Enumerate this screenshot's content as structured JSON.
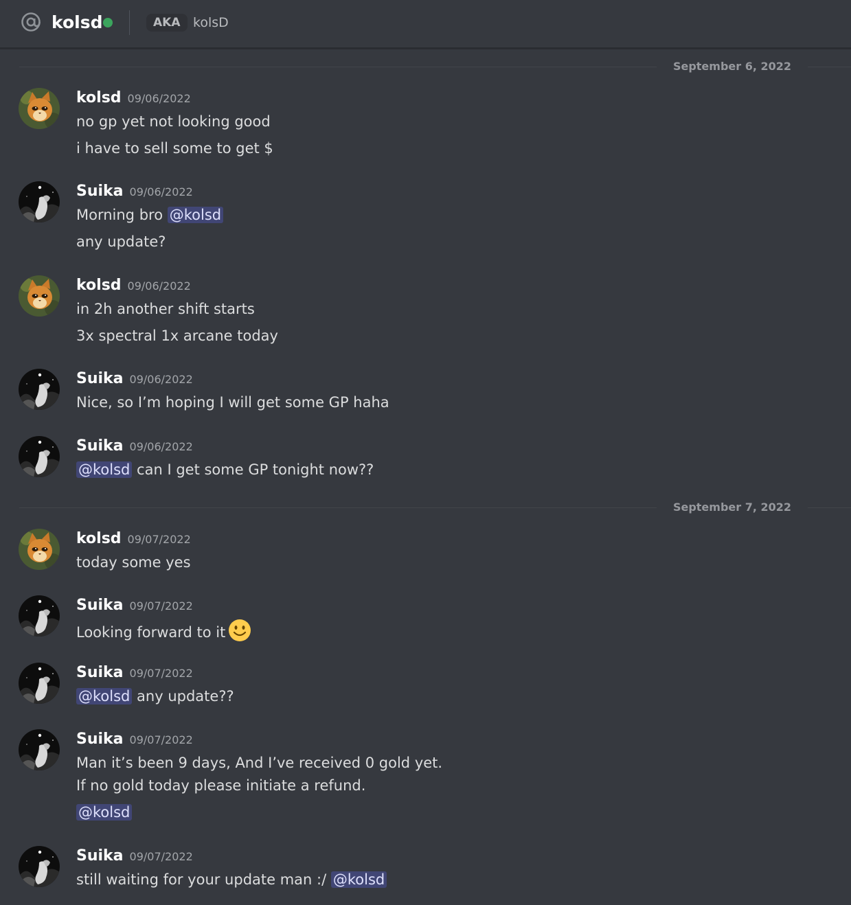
{
  "header": {
    "title": "kolsd",
    "status_color": "#3ba55d",
    "aka_label": "AKA",
    "aka_name": "kolsD",
    "icon": "at-sign-icon"
  },
  "colors": {
    "background": "#36393f",
    "mention_bg": "#414675",
    "mention_text": "#dee0fc",
    "online": "#3ba55d"
  },
  "date_dividers": [
    "September 6, 2022",
    "September 7, 2022"
  ],
  "messages": [
    {
      "author": "kolsd",
      "timestamp": "09/06/2022",
      "avatar": "cat-avatar",
      "lines": [
        [
          {
            "text": "no gp yet not looking good"
          }
        ],
        [
          {
            "text": "i have to sell some to get $"
          }
        ]
      ]
    },
    {
      "author": "Suika",
      "timestamp": "09/06/2022",
      "avatar": "dark-avatar",
      "lines": [
        [
          {
            "text": "Morning bro "
          },
          {
            "mention": "@kolsd"
          }
        ],
        [
          {
            "text": "any update?"
          }
        ]
      ]
    },
    {
      "author": "kolsd",
      "timestamp": "09/06/2022",
      "avatar": "cat-avatar",
      "lines": [
        [
          {
            "text": "in 2h another shift starts"
          }
        ],
        [
          {
            "text": "3x spectral 1x arcane today"
          }
        ]
      ]
    },
    {
      "author": "Suika",
      "timestamp": "09/06/2022",
      "avatar": "dark-avatar",
      "lines": [
        [
          {
            "text": "Nice, so I’m hoping I will get some GP haha"
          }
        ]
      ]
    },
    {
      "author": "Suika",
      "timestamp": "09/06/2022",
      "avatar": "dark-avatar",
      "lines": [
        [
          {
            "mention": "@kolsd"
          },
          {
            "text": " can I get some GP tonight now??"
          }
        ]
      ]
    },
    {
      "author": "kolsd",
      "timestamp": "09/07/2022",
      "avatar": "cat-avatar",
      "lines": [
        [
          {
            "text": "today some yes"
          }
        ]
      ]
    },
    {
      "author": "Suika",
      "timestamp": "09/07/2022",
      "avatar": "dark-avatar",
      "lines": [
        [
          {
            "text": "Looking forward to it"
          },
          {
            "emoji": "slightly-smiling-face-emoji"
          }
        ]
      ]
    },
    {
      "author": "Suika",
      "timestamp": "09/07/2022",
      "avatar": "dark-avatar",
      "lines": [
        [
          {
            "mention": "@kolsd"
          },
          {
            "text": " any update??"
          }
        ]
      ]
    },
    {
      "author": "Suika",
      "timestamp": "09/07/2022",
      "avatar": "dark-avatar",
      "lines": [
        [
          {
            "text": "Man it’s been 9 days, And I’ve received 0 gold yet."
          }
        ],
        [
          {
            "text": "If no gold today please initiate a refund."
          }
        ],
        [
          {
            "mention": "@kolsd"
          }
        ]
      ]
    },
    {
      "author": "Suika",
      "timestamp": "09/07/2022",
      "avatar": "dark-avatar",
      "lines": [
        [
          {
            "text": "still waiting for your update man :/ "
          },
          {
            "mention": "@kolsd"
          }
        ]
      ]
    }
  ]
}
